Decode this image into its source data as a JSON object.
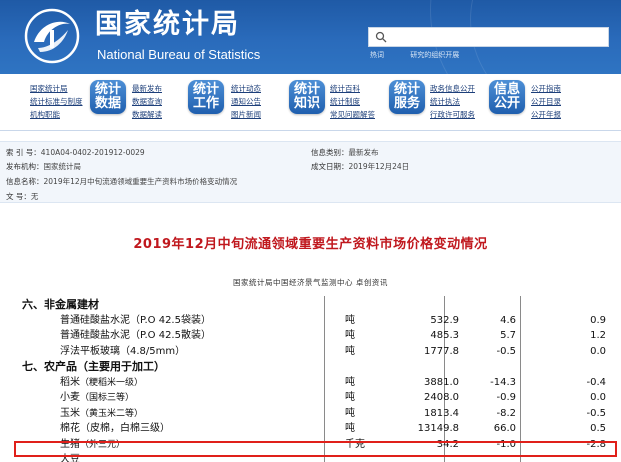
{
  "site": {
    "name_cn": "国家统计局",
    "name_en": "National Bureau of Statistics",
    "search_placeholder": "",
    "hot_label": "热词",
    "hot_words": [
      "",
      ""
    ],
    "hot_tail": "研究的组织开展"
  },
  "nav": {
    "col1": [
      "国家统计局",
      "统计标准与制度",
      "机构职能"
    ],
    "btn1": [
      "统计",
      "数据"
    ],
    "col2": [
      "最新发布",
      "数据查询",
      "数据解读"
    ],
    "btn2": [
      "统计",
      "工作"
    ],
    "col3": [
      "统计动态",
      "通知公告",
      "图片新闻"
    ],
    "btn3": [
      "统计",
      "知识"
    ],
    "col4": [
      "统计百科",
      "统计制度",
      "常见问题解答"
    ],
    "btn4": [
      "统计",
      "服务"
    ],
    "col5": [
      "政务信息公开",
      "统计执法",
      "行政许可服务"
    ],
    "btn5": [
      "信息",
      "公开"
    ],
    "col6": [
      "公开指南",
      "公开目录",
      "公开年报"
    ]
  },
  "info": {
    "index_label": "索 引 号：",
    "index_value": "410A04-0402-201912-0029",
    "publisher_label": "发布机构：",
    "publisher_value": "国家统计局",
    "name_label": "信息名称：",
    "name_value": "2019年12月中旬流通领域重要生产资料市场价格变动情况",
    "docno_label": "文    号：",
    "docno_value": "无",
    "category_label": "信息类别：",
    "category_value": "最新发布",
    "date_label": "成文日期：",
    "date_value": "2019年12月24日"
  },
  "article": {
    "title": "2019年12月中旬流通领域重要生产资料市场价格变动情况",
    "subtitle": "国家统计局中国经济景气监测中心  卓创资讯"
  },
  "table": {
    "rows": [
      {
        "type": "cat",
        "name": "六、非金属建材",
        "unit": "",
        "price": "",
        "change": "",
        "pct": ""
      },
      {
        "type": "item",
        "name": "普通硅酸盐水泥（P.O 42.5袋装）",
        "unit": "吨",
        "price": "532.9",
        "change": "4.6",
        "pct": "0.9"
      },
      {
        "type": "item",
        "name": "普通硅酸盐水泥（P.O 42.5散装）",
        "unit": "吨",
        "price": "485.3",
        "change": "5.7",
        "pct": "1.2"
      },
      {
        "type": "item",
        "name": "浮法平板玻璃（4.8/5mm）",
        "unit": "吨",
        "price": "1777.8",
        "change": "-0.5",
        "pct": "0.0"
      },
      {
        "type": "cat",
        "name": "七、农产品（主要用于加工）",
        "unit": "",
        "price": "",
        "change": "",
        "pct": ""
      },
      {
        "type": "item",
        "name": "稻米",
        "note": "（粳稻米一级）",
        "unit": "吨",
        "price": "3881.0",
        "change": "-14.3",
        "pct": "-0.4"
      },
      {
        "type": "item",
        "name": "小麦",
        "note": "（国标三等）",
        "unit": "吨",
        "price": "2408.0",
        "change": "-0.9",
        "pct": "0.0"
      },
      {
        "type": "item",
        "name": "玉米",
        "note": "（黄玉米二等）",
        "unit": "吨",
        "price": "1813.4",
        "change": "-8.2",
        "pct": "-0.5"
      },
      {
        "type": "item",
        "name": "棉花（皮棉，白棉三级）",
        "unit": "吨",
        "price": "13149.8",
        "change": "66.0",
        "pct": "0.5"
      },
      {
        "type": "item",
        "name": "生猪",
        "note": "（外三元）",
        "unit": "千克",
        "price": "34.2",
        "change": "-1.0",
        "pct": "-2.8"
      },
      {
        "type": "item",
        "name": "大豆",
        "note": "",
        "unit": "",
        "price": "",
        "change": "",
        "pct": ""
      }
    ]
  },
  "colors": {
    "header_blue": "#2a6bbb",
    "title_red": "#c0181e",
    "highlight_red": "#e0201a"
  }
}
